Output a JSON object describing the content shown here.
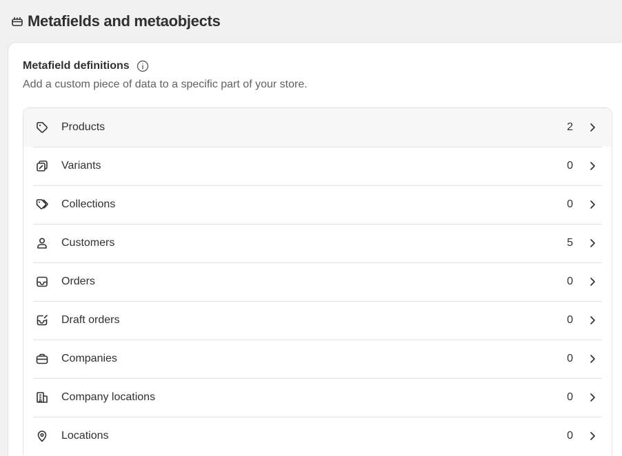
{
  "header": {
    "title": "Metafields and metaobjects",
    "icon": "metafield-icon"
  },
  "card": {
    "title": "Metafield definitions",
    "subtitle": "Add a custom piece of data to a specific part of your store."
  },
  "rows": [
    {
      "label": "Products",
      "count": "2",
      "icon": "tag-icon"
    },
    {
      "label": "Variants",
      "count": "0",
      "icon": "variant-icon"
    },
    {
      "label": "Collections",
      "count": "0",
      "icon": "collection-icon"
    },
    {
      "label": "Customers",
      "count": "5",
      "icon": "person-icon"
    },
    {
      "label": "Orders",
      "count": "0",
      "icon": "inbox-icon"
    },
    {
      "label": "Draft orders",
      "count": "0",
      "icon": "draft-order-icon"
    },
    {
      "label": "Companies",
      "count": "0",
      "icon": "briefcase-icon"
    },
    {
      "label": "Company locations",
      "count": "0",
      "icon": "building-icon"
    },
    {
      "label": "Locations",
      "count": "0",
      "icon": "location-pin-icon"
    }
  ],
  "colors": {
    "background": "#f1f1f1",
    "card": "#ffffff",
    "text": "#303030",
    "subtext": "#616161",
    "divider": "#e3e3e3",
    "active_row": "#f7f7f7"
  }
}
